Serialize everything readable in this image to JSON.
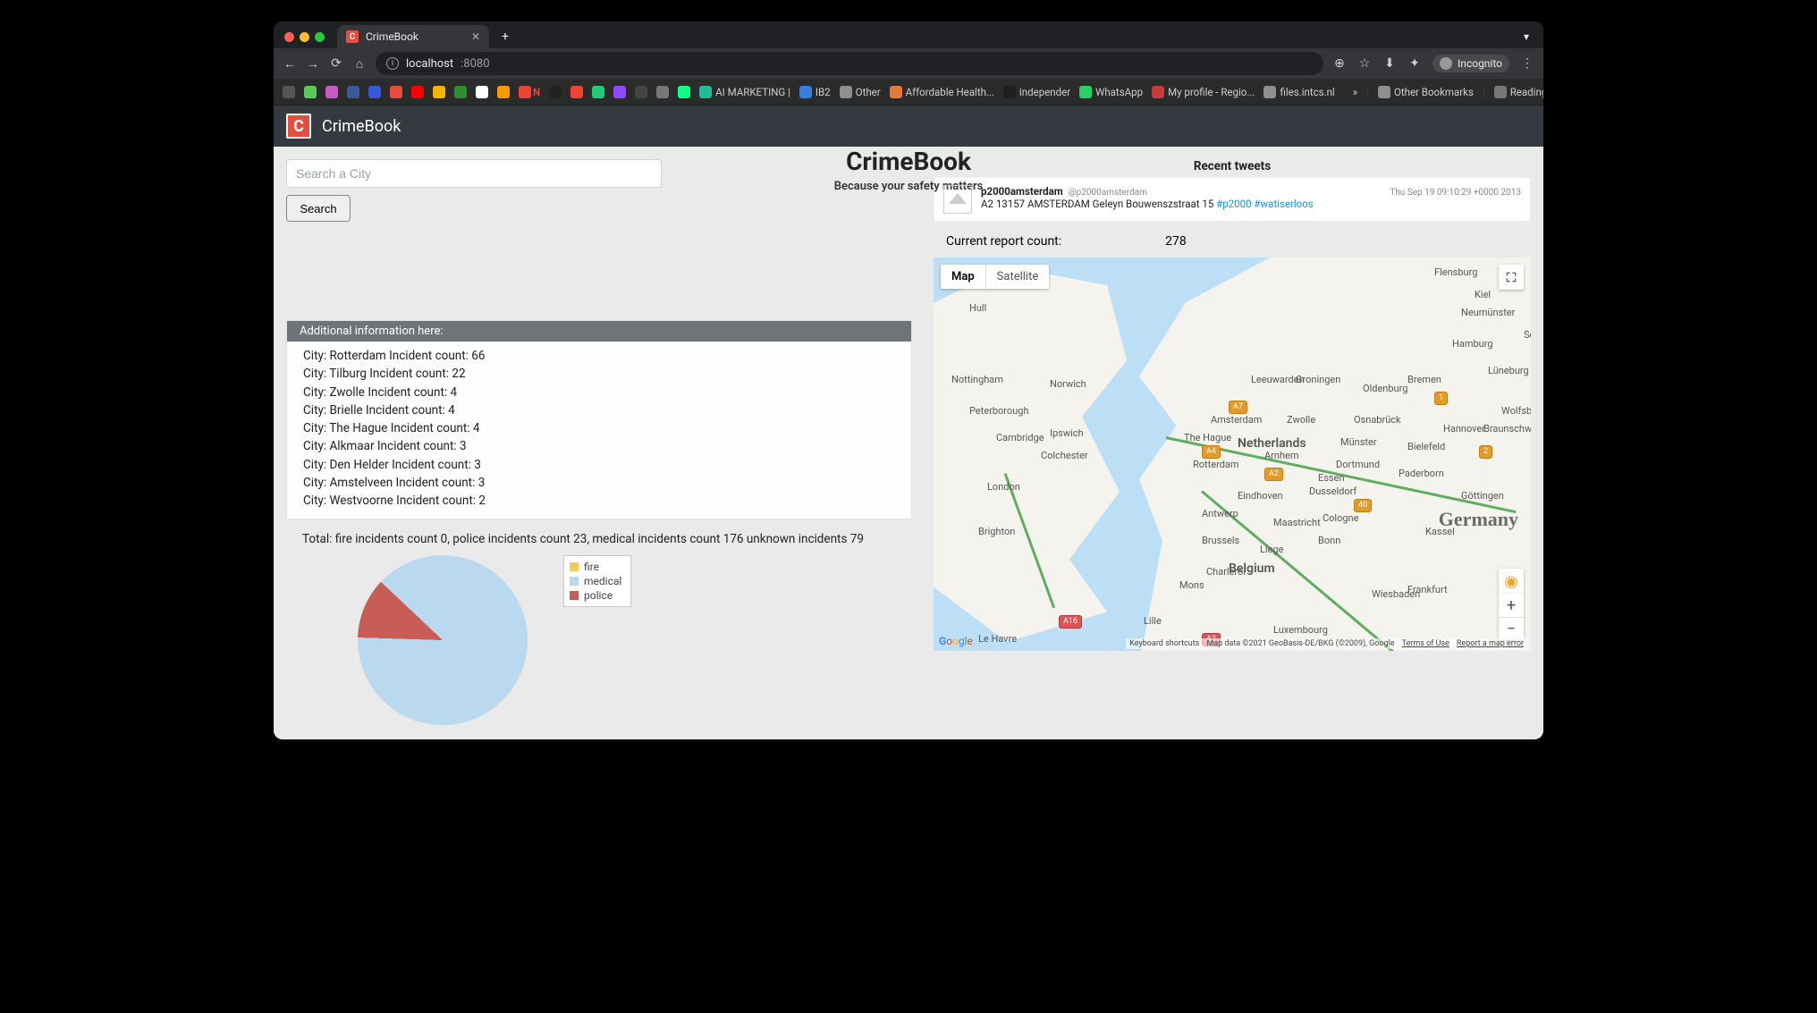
{
  "browser": {
    "tab_title": "CrimeBook",
    "url_host": "localhost",
    "url_port": ":8080",
    "incognito_label": "Incognito",
    "bookmarks": [
      "AI MARKETING |",
      "IB2",
      "Other",
      "Affordable Health...",
      "independer",
      "WhatsApp",
      "My profile - Regio...",
      "files.intcs.nl"
    ],
    "more_bookmarks": "»",
    "other_bookmarks": "Other Bookmarks",
    "reading_list": "Reading List"
  },
  "app": {
    "brand": "CrimeBook",
    "logo_letter": "C"
  },
  "search": {
    "placeholder": "Search a City",
    "button": "Search"
  },
  "hero": {
    "title": "CrimeBook",
    "subtitle": "Because your safety matters"
  },
  "info": {
    "header": "Additional information here:",
    "label_city": "City:",
    "label_count": "Incident count:",
    "rows": [
      {
        "city": "Rotterdam",
        "count": 66
      },
      {
        "city": "Tilburg",
        "count": 22
      },
      {
        "city": "Zwolle",
        "count": 4
      },
      {
        "city": "Brielle",
        "count": 4
      },
      {
        "city": "The Hague",
        "count": 4
      },
      {
        "city": "Alkmaar",
        "count": 3
      },
      {
        "city": "Den Helder",
        "count": 3
      },
      {
        "city": "Amstelveen",
        "count": 3
      },
      {
        "city": "Westvoorne",
        "count": 2
      }
    ]
  },
  "totals": {
    "prefix": "Total:",
    "fire_label": "fire incidents count",
    "fire": 0,
    "police_label": "police incidents count",
    "police": 23,
    "medical_label": "medical incidents count",
    "medical": 176,
    "unknown_label": "unknown incidents",
    "unknown": 79
  },
  "chart_data": {
    "type": "pie",
    "title": "",
    "series": [
      {
        "name": "fire",
        "value": 0,
        "color": "#f2cc5a"
      },
      {
        "name": "medical",
        "value": 176,
        "color": "#bad9ef"
      },
      {
        "name": "police",
        "value": 23,
        "color": "#c85d55"
      }
    ]
  },
  "tweets": {
    "title": "Recent tweets",
    "item": {
      "name": "p2000amsterdam",
      "handle": "@p2000amsterdam",
      "timestamp": "Thu Sep 19 09:10:29 +0000 2013",
      "text_prefix": "A2 13157 AMSTERDAM Geleyn Bouwenszstraat 15 ",
      "hashtag1": "#p2000",
      "hashtag2": "#watiserloos"
    }
  },
  "report": {
    "label": "Current report count:",
    "value": 278
  },
  "map": {
    "tab_map": "Map",
    "tab_satellite": "Satellite",
    "big_labels": {
      "germany": "Germany"
    },
    "countries": {
      "netherlands": "Netherlands",
      "belgium": "Belgium"
    },
    "cities": [
      "Hull",
      "Nottingham",
      "Peterborough",
      "Cambridge",
      "Norwich",
      "Ipswich",
      "Colchester",
      "London",
      "Brighton",
      "Lille",
      "The Hague",
      "Amsterdam",
      "Rotterdam",
      "Eindhoven",
      "Antwerp",
      "Brussels",
      "Mons",
      "Leeuwarden",
      "Groningen",
      "Zwolle",
      "Arnhem",
      "Dusseldorf",
      "Cologne",
      "Bonn",
      "Dortmund",
      "Essen",
      "Bremen",
      "Hamburg",
      "Hannover",
      "Bielefeld",
      "Paderborn",
      "Kassel",
      "Frankfurt",
      "Wiesbaden",
      "Braunschweig",
      "Wolfsburg",
      "Neumünster",
      "Kiel",
      "Flensburg",
      "Schwerin",
      "Lüneburg",
      "Luxembourg",
      "Göttingen",
      "Le Havre",
      "Charleroi",
      "Münster",
      "Osnabrück",
      "Oldenburg",
      "Liege",
      "Maastricht"
    ],
    "footer": {
      "shortcuts": "Keyboard shortcuts",
      "mapdata": "Map data ©2021 GeoBasis-DE/BKG (©2009), Google",
      "terms": "Terms of Use",
      "report": "Report a map error"
    },
    "google": "Google"
  }
}
